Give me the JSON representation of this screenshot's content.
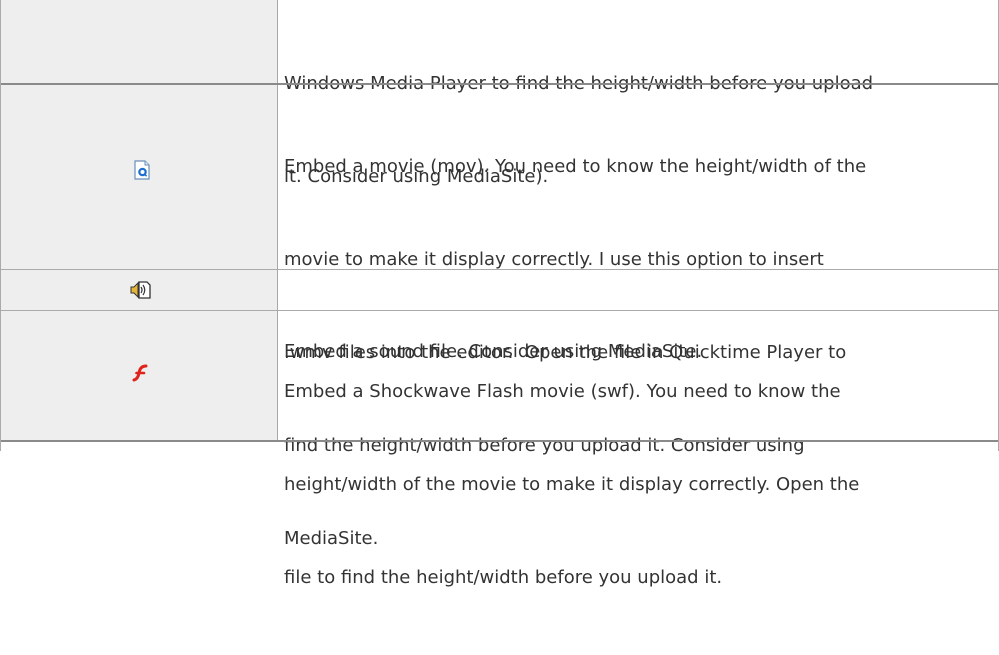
{
  "rows": [
    {
      "icon": "",
      "lines": [
        "Windows Media Player to find the height/width before you upload",
        "it. Consider using MediaSite)."
      ]
    },
    {
      "icon": "quicktime-movie-icon",
      "lines": [
        "Embed a movie (mov). You need to know the height/width of the",
        "movie to make it display correctly. I use this option to insert",
        ".wmv files into the editor.  Open the file in Quicktime Player to",
        "find the height/width before you upload it. Consider using",
        "MediaSite."
      ]
    },
    {
      "icon": "sound-file-icon",
      "lines": [
        "Embed a sound file. Consider using MediaSite."
      ]
    },
    {
      "icon": "flash-icon",
      "lines": [
        "Embed a Shockwave Flash movie (swf). You need to know the",
        "height/width of the movie to make it display correctly. Open the",
        "file to find the height/width before you upload it."
      ]
    }
  ],
  "colors": {
    "icon_cell_bg": "#eeeeee",
    "text": "#333333",
    "border": "#aaaaaa",
    "flash_red": "#e0241b",
    "quicktime_blue": "#1f6fd1"
  }
}
